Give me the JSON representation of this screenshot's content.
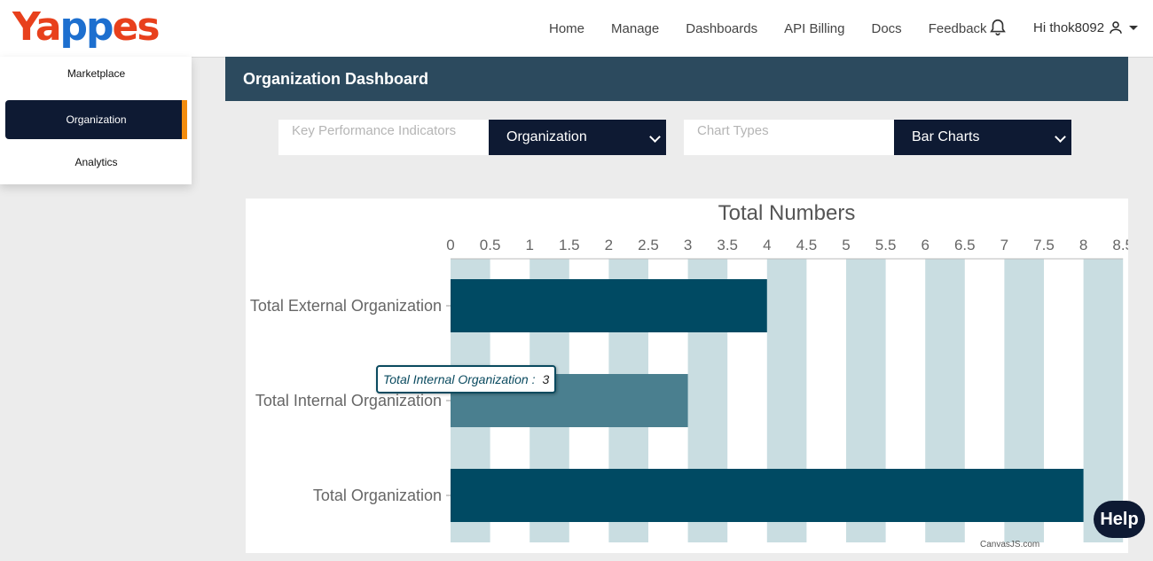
{
  "brand": {
    "logo_part1": "Ya",
    "logo_part2": "pp",
    "logo_part3": "es"
  },
  "nav": {
    "links": [
      "Home",
      "Manage",
      "Dashboards",
      "API Billing",
      "Docs",
      "Feedback"
    ],
    "greeting": "Hi thok8092"
  },
  "sidebar": {
    "items": [
      {
        "label": "Marketplace",
        "active": false
      },
      {
        "label": "Organization",
        "active": true
      },
      {
        "label": "Analytics",
        "active": false
      }
    ]
  },
  "dashboard": {
    "title": "Organization Dashboard"
  },
  "filters": {
    "kpi_placeholder": "Key Performance Indicators",
    "kpi_value": "Organization",
    "chart_placeholder": "Chart Types",
    "chart_value": "Bar Charts"
  },
  "tooltip": {
    "label": "Total Internal Organization :",
    "value": "3"
  },
  "help_label": "Help",
  "credit": "CanvasJS.com",
  "colors": {
    "bar_primary": "#004a63",
    "bar_hover": "#4a7f8f",
    "stripe": "#c9dde1",
    "navy": "#0e1a33"
  },
  "chart_data": {
    "type": "bar",
    "orientation": "horizontal",
    "title": "Total Numbers",
    "categories": [
      "Total External Organization",
      "Total Internal Organization",
      "Total Organization"
    ],
    "values": [
      4,
      3,
      8
    ],
    "xlim": [
      0,
      8.5
    ],
    "ticks": [
      "0",
      "0.5",
      "1",
      "1.5",
      "2",
      "2.5",
      "3",
      "3.5",
      "4",
      "4.5",
      "5",
      "5.5",
      "6",
      "6.5",
      "7",
      "7.5",
      "8",
      "8.5"
    ],
    "grid": "alternating vertical stripes"
  }
}
